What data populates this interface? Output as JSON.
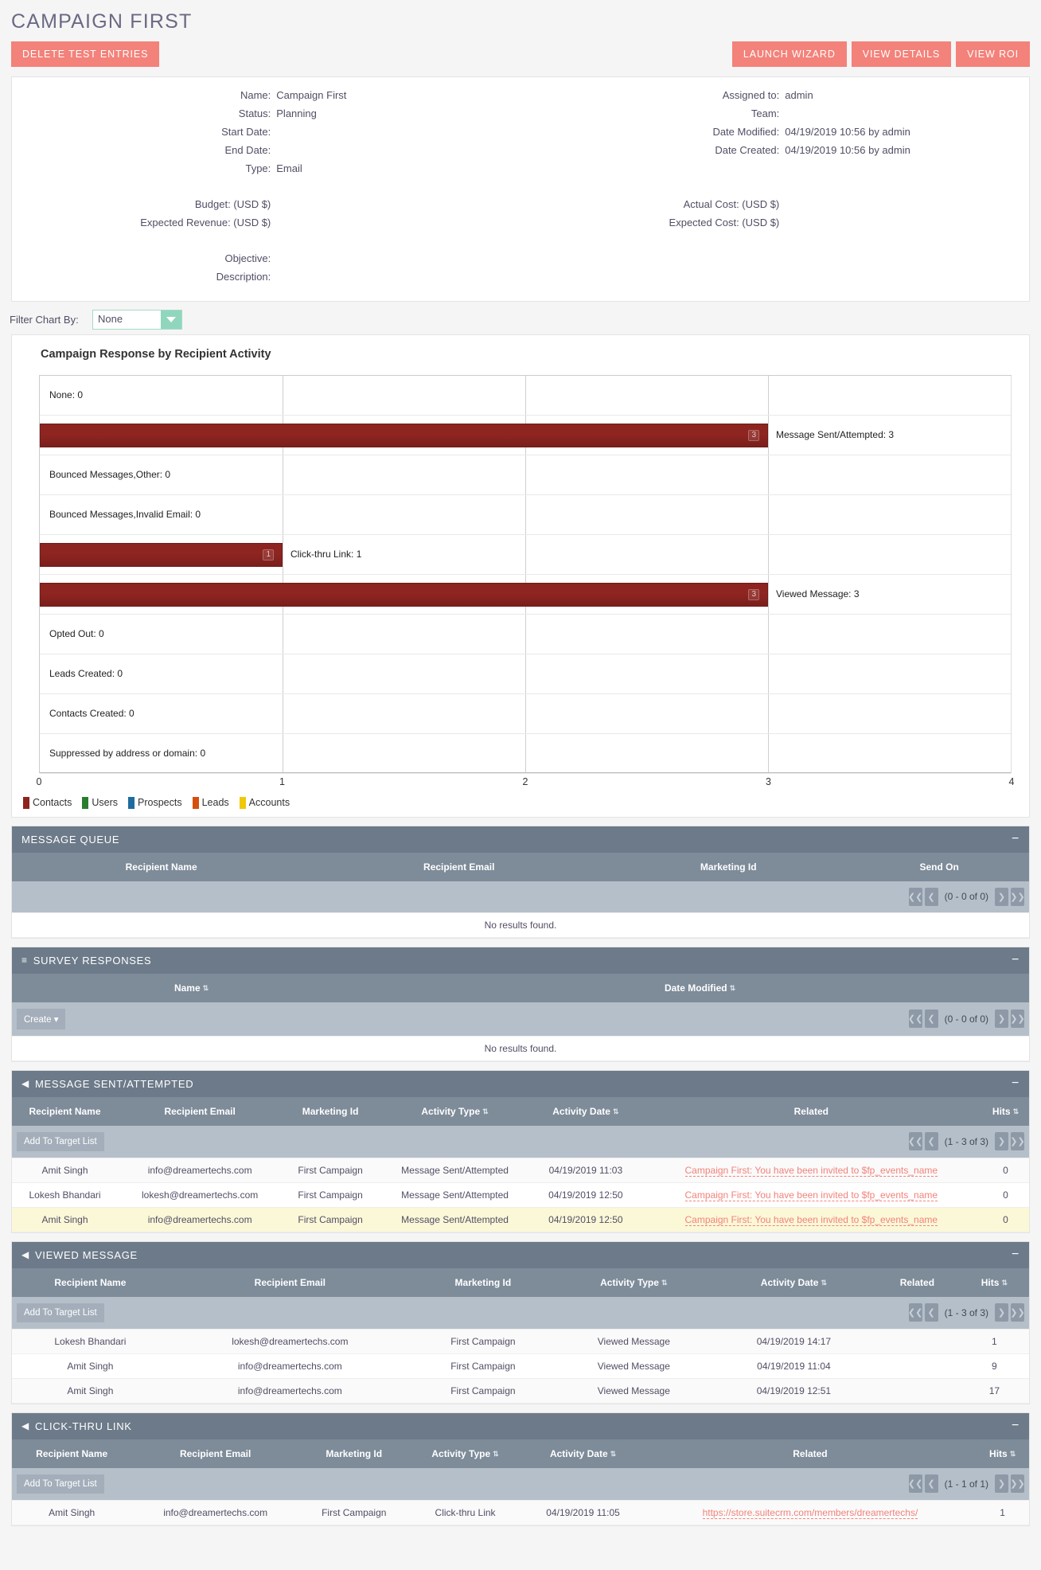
{
  "header": {
    "title": "CAMPAIGN FIRST",
    "delete_button": "DELETE TEST ENTRIES",
    "launch_wizard": "LAUNCH WIZARD",
    "view_details": "VIEW DETAILS",
    "view_roi": "VIEW ROI"
  },
  "detail": {
    "left": [
      {
        "label": "Name:",
        "value": "Campaign First"
      },
      {
        "label": "Status:",
        "value": "Planning"
      },
      {
        "label": "Start Date:",
        "value": ""
      },
      {
        "label": "End Date:",
        "value": ""
      },
      {
        "label": "Type:",
        "value": "Email"
      }
    ],
    "right": [
      {
        "label": "Assigned to:",
        "value": "admin"
      },
      {
        "label": "Team:",
        "value": ""
      },
      {
        "label": "Date Modified:",
        "value": "04/19/2019 10:56 by admin"
      },
      {
        "label": "Date Created:",
        "value": "04/19/2019 10:56 by admin"
      },
      {
        "label": "",
        "value": ""
      }
    ],
    "left2": [
      {
        "label": "Budget: (USD $)",
        "value": ""
      },
      {
        "label": "Expected Revenue: (USD $)",
        "value": ""
      }
    ],
    "right2": [
      {
        "label": "Actual Cost: (USD $)",
        "value": ""
      },
      {
        "label": "Expected Cost: (USD $)",
        "value": ""
      }
    ],
    "left3": [
      {
        "label": "Objective:",
        "value": ""
      },
      {
        "label": "Description:",
        "value": ""
      }
    ]
  },
  "filter": {
    "label": "Filter Chart By:",
    "selected": "None"
  },
  "chart_data": {
    "type": "bar",
    "orientation": "horizontal",
    "title": "Campaign Response by Recipient Activity",
    "xlabel": "",
    "ylabel": "",
    "xlim": [
      0,
      4
    ],
    "xticks": [
      "0",
      "1",
      "2",
      "3",
      "4"
    ],
    "grid": true,
    "categories": [
      "None",
      "Message Sent/Attempted",
      "Bounced Messages,Other",
      "Bounced Messages,Invalid Email",
      "Click-thru Link",
      "Viewed Message",
      "Opted Out",
      "Leads Created",
      "Contacts Created",
      "Suppressed by address or domain"
    ],
    "values": [
      0,
      3,
      0,
      0,
      1,
      3,
      0,
      0,
      0,
      0
    ],
    "bar_labels": [
      "None: 0",
      "Message Sent/Attempted: 3",
      "Bounced Messages,Other: 0",
      "Bounced Messages,Invalid Email: 0",
      "Click-thru Link: 1",
      "Viewed Message: 3",
      "Opted Out: 0",
      "Leads Created: 0",
      "Contacts Created: 0",
      "Suppressed by address or domain: 0"
    ],
    "series": [
      {
        "name": "Contacts",
        "color": "#8c2420",
        "values": [
          0,
          3,
          0,
          0,
          1,
          3,
          0,
          0,
          0,
          0
        ]
      }
    ],
    "legend": [
      {
        "label": "Contacts",
        "color": "#8c2420"
      },
      {
        "label": "Users",
        "color": "#2a7d2e"
      },
      {
        "label": "Prospects",
        "color": "#1e6ca0"
      },
      {
        "label": "Leads",
        "color": "#d4500c"
      },
      {
        "label": "Accounts",
        "color": "#f0c808"
      }
    ],
    "legend_position": "bottom-left"
  },
  "panels": [
    {
      "id": "message-queue",
      "title": "MESSAGE QUEUE",
      "icon": "",
      "collapse": "−",
      "columns": [
        {
          "label": "Recipient Name",
          "sortable": false
        },
        {
          "label": "Recipient Email",
          "sortable": false
        },
        {
          "label": "Marketing Id",
          "sortable": false
        },
        {
          "label": "Send On",
          "sortable": false
        }
      ],
      "toolbar_button": "",
      "pager_count": "(0 - 0 of 0)",
      "rows": [],
      "empty_text": "No results found."
    },
    {
      "id": "survey-responses",
      "title": "SURVEY RESPONSES",
      "icon": "≡",
      "collapse": "−",
      "columns": [
        {
          "label": "Name",
          "sortable": true
        },
        {
          "label": "Date Modified",
          "sortable": true
        }
      ],
      "toolbar_button": "Create",
      "pager_count": "(0 - 0 of 0)",
      "rows": [],
      "empty_text": "No results found."
    },
    {
      "id": "message-sent-attempted",
      "title": "MESSAGE SENT/ATTEMPTED",
      "icon": "◀",
      "collapse": "−",
      "columns": [
        {
          "label": "Recipient Name",
          "sortable": false
        },
        {
          "label": "Recipient Email",
          "sortable": false
        },
        {
          "label": "Marketing Id",
          "sortable": false
        },
        {
          "label": "Activity Type",
          "sortable": true
        },
        {
          "label": "Activity Date",
          "sortable": true
        },
        {
          "label": "Related",
          "sortable": false
        },
        {
          "label": "Hits",
          "sortable": true
        }
      ],
      "toolbar_button": "Add To Target List",
      "pager_count": "(1 - 3 of 3)",
      "rows": [
        [
          "Amit Singh",
          "info@dreamertechs.com",
          "First Campaign",
          "Message Sent/Attempted",
          "04/19/2019 11:03",
          "Campaign First: You have been invited to $fp_events_name",
          "0"
        ],
        [
          "Lokesh Bhandari",
          "lokesh@dreamertechs.com",
          "First Campaign",
          "Message Sent/Attempted",
          "04/19/2019 12:50",
          "Campaign First: You have been invited to $fp_events_name",
          "0"
        ],
        [
          "Amit Singh",
          "info@dreamertechs.com",
          "First Campaign",
          "Message Sent/Attempted",
          "04/19/2019 12:50",
          "Campaign First: You have been invited to $fp_events_name",
          "0"
        ]
      ],
      "link_column": 5,
      "empty_text": ""
    },
    {
      "id": "viewed-message",
      "title": "VIEWED MESSAGE",
      "icon": "◀",
      "collapse": "−",
      "columns": [
        {
          "label": "Recipient Name",
          "sortable": false
        },
        {
          "label": "Recipient Email",
          "sortable": false
        },
        {
          "label": "Marketing Id",
          "sortable": false
        },
        {
          "label": "Activity Type",
          "sortable": true
        },
        {
          "label": "Activity Date",
          "sortable": true
        },
        {
          "label": "Related",
          "sortable": false
        },
        {
          "label": "Hits",
          "sortable": true
        }
      ],
      "toolbar_button": "Add To Target List",
      "pager_count": "(1 - 3 of 3)",
      "rows": [
        [
          "Lokesh Bhandari",
          "lokesh@dreamertechs.com",
          "First Campaign",
          "Viewed Message",
          "04/19/2019 14:17",
          "",
          "1"
        ],
        [
          "Amit Singh",
          "info@dreamertechs.com",
          "First Campaign",
          "Viewed Message",
          "04/19/2019 11:04",
          "",
          "9"
        ],
        [
          "Amit Singh",
          "info@dreamertechs.com",
          "First Campaign",
          "Viewed Message",
          "04/19/2019 12:51",
          "",
          "17"
        ]
      ],
      "link_column": -1,
      "empty_text": ""
    },
    {
      "id": "click-thru-link",
      "title": "CLICK-THRU LINK",
      "icon": "◀",
      "collapse": "−",
      "columns": [
        {
          "label": "Recipient Name",
          "sortable": false
        },
        {
          "label": "Recipient Email",
          "sortable": false
        },
        {
          "label": "Marketing Id",
          "sortable": false
        },
        {
          "label": "Activity Type",
          "sortable": true
        },
        {
          "label": "Activity Date",
          "sortable": true
        },
        {
          "label": "Related",
          "sortable": false
        },
        {
          "label": "Hits",
          "sortable": true
        }
      ],
      "toolbar_button": "Add To Target List",
      "pager_count": "(1 - 1 of 1)",
      "rows": [
        [
          "Amit Singh",
          "info@dreamertechs.com",
          "First Campaign",
          "Click-thru Link",
          "04/19/2019 11:05",
          "https://store.suitecrm.com/members/dreamertechs/",
          "1"
        ]
      ],
      "link_column": 5,
      "empty_text": ""
    }
  ],
  "pager_icons": {
    "first": "❮❮",
    "prev": "❮",
    "next": "❯",
    "last": "❯❯"
  }
}
